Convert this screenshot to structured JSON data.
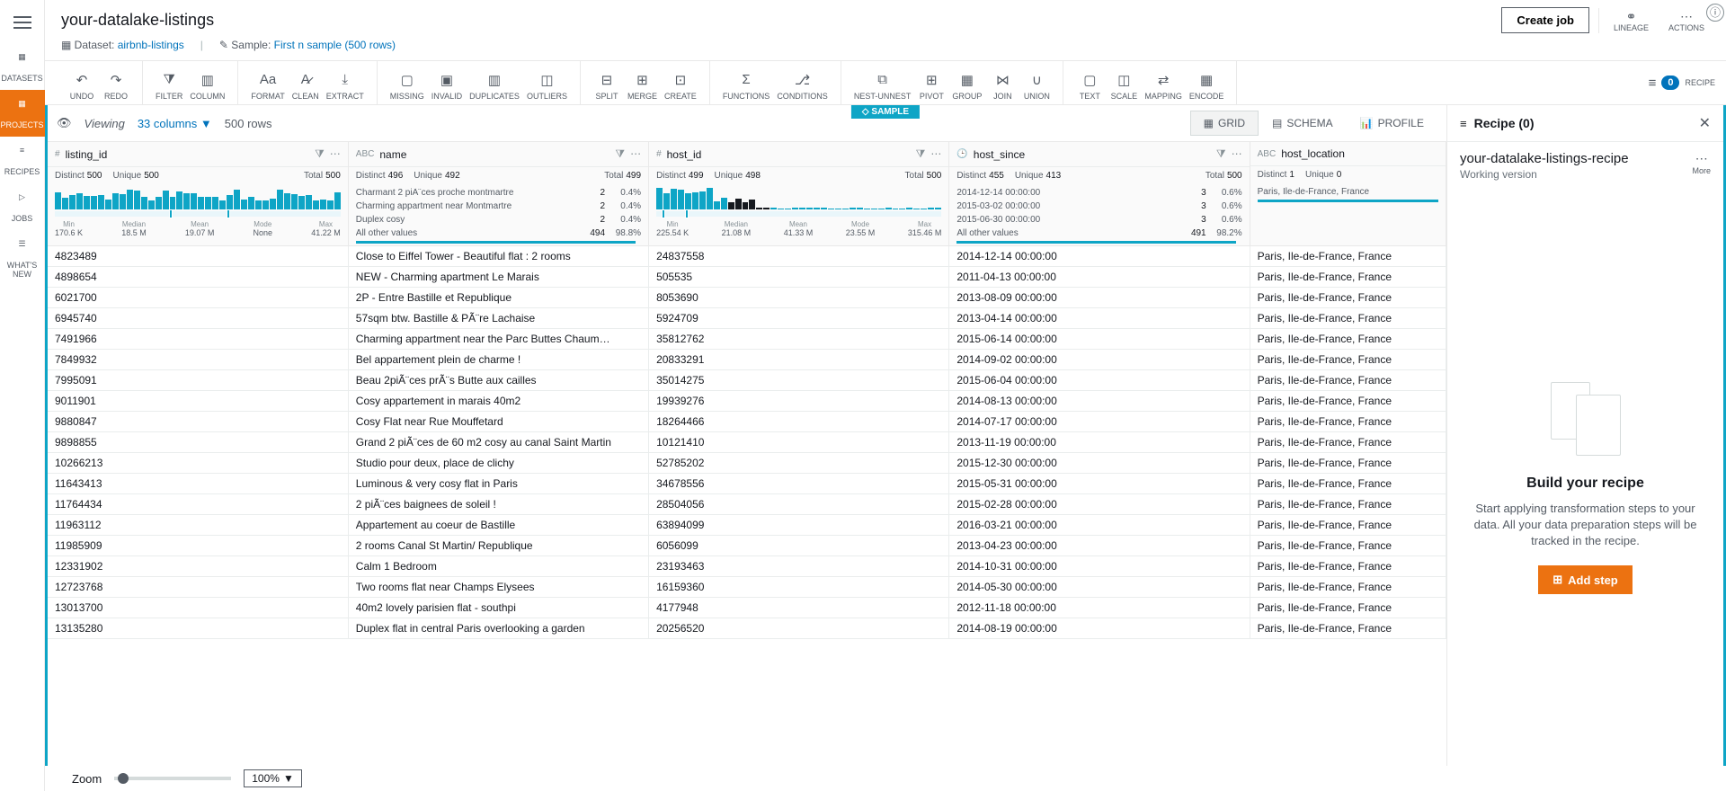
{
  "project_title": "your-datalake-listings",
  "dataset_label": "Dataset:",
  "dataset_link": "airbnb-listings",
  "sample_label": "Sample:",
  "sample_link": "First n sample (500 rows)",
  "create_job": "Create job",
  "lineage": "LINEAGE",
  "actions": "ACTIONS",
  "nav": {
    "datasets": "DATASETS",
    "projects": "PROJECTS",
    "recipes": "RECIPES",
    "jobs": "JOBS",
    "whatsnew": "WHAT'S NEW"
  },
  "toolbar": {
    "undo": "UNDO",
    "redo": "REDO",
    "filter": "FILTER",
    "column": "COLUMN",
    "format": "FORMAT",
    "clean": "CLEAN",
    "extract": "EXTRACT",
    "missing": "MISSING",
    "invalid": "INVALID",
    "duplicates": "DUPLICATES",
    "outliers": "OUTLIERS",
    "split": "SPLIT",
    "merge": "MERGE",
    "create": "CREATE",
    "functions": "FUNCTIONS",
    "conditions": "CONDITIONS",
    "nest": "NEST-UNNEST",
    "pivot": "PIVOT",
    "group": "GROUP",
    "join": "JOIN",
    "union": "UNION",
    "text": "TEXT",
    "scale": "SCALE",
    "mapping": "MAPPING",
    "encode": "ENCODE",
    "recipe": "RECIPE"
  },
  "recipe_badge": "0",
  "sample_tag": "SAMPLE",
  "viewing": "Viewing",
  "cols_count": "33 columns",
  "rows_count": "500 rows",
  "tabs": {
    "grid": "GRID",
    "schema": "SCHEMA",
    "profile": "PROFILE"
  },
  "columns": {
    "listing_id": {
      "name": "listing_id",
      "distinct": "500",
      "unique": "500",
      "total": "500",
      "summary": [
        [
          "Min",
          "170.6 K"
        ],
        [
          "Median",
          "18.5 M"
        ],
        [
          "Mean",
          "19.07 M"
        ],
        [
          "Mode",
          "None"
        ],
        [
          "Max",
          "41.22 M"
        ]
      ]
    },
    "name": {
      "name": "name",
      "distinct": "496",
      "unique": "492",
      "total": "499",
      "freq": [
        {
          "v": "Charmant 2 piÃ¨ces proche montmartre",
          "c": "2",
          "p": "0.4%"
        },
        {
          "v": "Charming appartment near Montmartre",
          "c": "2",
          "p": "0.4%"
        },
        {
          "v": "Duplex cosy",
          "c": "2",
          "p": "0.4%"
        },
        {
          "v": "All other values",
          "c": "494",
          "p": "98.8%",
          "bar": 98
        }
      ]
    },
    "host_id": {
      "name": "host_id",
      "distinct": "499",
      "unique": "498",
      "total": "500",
      "summary": [
        [
          "Min",
          "225.54 K"
        ],
        [
          "Median",
          "21.08 M"
        ],
        [
          "Mean",
          "41.33 M"
        ],
        [
          "Mode",
          "23.55 M"
        ],
        [
          "Max",
          "315.46 M"
        ]
      ]
    },
    "host_since": {
      "name": "host_since",
      "distinct": "455",
      "unique": "413",
      "total": "500",
      "freq": [
        {
          "v": "2014-12-14 00:00:00",
          "c": "3",
          "p": "0.6%"
        },
        {
          "v": "2015-03-02 00:00:00",
          "c": "3",
          "p": "0.6%"
        },
        {
          "v": "2015-06-30 00:00:00",
          "c": "3",
          "p": "0.6%"
        },
        {
          "v": "All other values",
          "c": "491",
          "p": "98.2%",
          "bar": 98
        }
      ]
    },
    "host_location": {
      "name": "host_location",
      "distinct": "1",
      "unique": "0",
      "freq": [
        {
          "v": "Paris, Ile-de-France, France"
        }
      ]
    }
  },
  "rows": [
    {
      "id": "4823489",
      "name": "Close to Eiffel Tower - Beautiful flat : 2 rooms",
      "host": "24837558",
      "since": "2014-12-14 00:00:00",
      "loc": "Paris, Ile-de-France, France"
    },
    {
      "id": "4898654",
      "name": "NEW - Charming apartment Le Marais",
      "host": "505535",
      "since": "2011-04-13 00:00:00",
      "loc": "Paris, Ile-de-France, France"
    },
    {
      "id": "6021700",
      "name": "2P - Entre Bastille et Republique",
      "host": "8053690",
      "since": "2013-08-09 00:00:00",
      "loc": "Paris, Ile-de-France, France"
    },
    {
      "id": "6945740",
      "name": "57sqm btw. Bastille & PÃ¨re Lachaise",
      "host": "5924709",
      "since": "2013-04-14 00:00:00",
      "loc": "Paris, Ile-de-France, France"
    },
    {
      "id": "7491966",
      "name": "Charming appartment near the Parc Buttes Chaum…",
      "host": "35812762",
      "since": "2015-06-14 00:00:00",
      "loc": "Paris, Ile-de-France, France"
    },
    {
      "id": "7849932",
      "name": "Bel appartement plein de charme !",
      "host": "20833291",
      "since": "2014-09-02 00:00:00",
      "loc": "Paris, Ile-de-France, France"
    },
    {
      "id": "7995091",
      "name": "Beau 2piÃ¨ces prÃ¨s Butte aux cailles",
      "host": "35014275",
      "since": "2015-06-04 00:00:00",
      "loc": "Paris, Ile-de-France, France"
    },
    {
      "id": "9011901",
      "name": "Cosy appartement in marais 40m2",
      "host": "19939276",
      "since": "2014-08-13 00:00:00",
      "loc": "Paris, Ile-de-France, France"
    },
    {
      "id": "9880847",
      "name": "Cosy Flat near Rue Mouffetard",
      "host": "18264466",
      "since": "2014-07-17 00:00:00",
      "loc": "Paris, Ile-de-France, France"
    },
    {
      "id": "9898855",
      "name": "Grand 2 piÃ¨ces de 60 m2 cosy au canal Saint Martin",
      "host": "10121410",
      "since": "2013-11-19 00:00:00",
      "loc": "Paris, Ile-de-France, France"
    },
    {
      "id": "10266213",
      "name": "Studio pour deux, place de clichy",
      "host": "52785202",
      "since": "2015-12-30 00:00:00",
      "loc": "Paris, Ile-de-France, France"
    },
    {
      "id": "11643413",
      "name": "Luminous & very cosy flat in Paris",
      "host": "34678556",
      "since": "2015-05-31 00:00:00",
      "loc": "Paris, Ile-de-France, France"
    },
    {
      "id": "11764434",
      "name": "2 piÃ¨ces baignees de soleil !",
      "host": "28504056",
      "since": "2015-02-28 00:00:00",
      "loc": "Paris, Ile-de-France, France"
    },
    {
      "id": "11963112",
      "name": "Appartement au coeur de Bastille",
      "host": "63894099",
      "since": "2016-03-21 00:00:00",
      "loc": "Paris, Ile-de-France, France"
    },
    {
      "id": "11985909",
      "name": "2 rooms Canal St Martin/ Republique",
      "host": "6056099",
      "since": "2013-04-23 00:00:00",
      "loc": "Paris, Ile-de-France, France"
    },
    {
      "id": "12331902",
      "name": "Calm 1 Bedroom",
      "host": "23193463",
      "since": "2014-10-31 00:00:00",
      "loc": "Paris, Ile-de-France, France"
    },
    {
      "id": "12723768",
      "name": "Two rooms flat near Champs Elysees",
      "host": "16159360",
      "since": "2014-05-30 00:00:00",
      "loc": "Paris, Ile-de-France, France"
    },
    {
      "id": "13013700",
      "name": "40m2 lovely parisien flat - southpi",
      "host": "4177948",
      "since": "2012-11-18 00:00:00",
      "loc": "Paris, Ile-de-France, France"
    },
    {
      "id": "13135280",
      "name": "Duplex flat in central Paris overlooking a garden",
      "host": "20256520",
      "since": "2014-08-19 00:00:00",
      "loc": "Paris, Ile-de-France, France"
    }
  ],
  "recipe_panel": {
    "title": "Recipe (0)",
    "name": "your-datalake-listings-recipe",
    "version": "Working version",
    "more": "More",
    "heading": "Build your recipe",
    "desc": "Start applying transformation steps to your data. All your data preparation steps will be tracked in the recipe.",
    "addstep": "Add step"
  },
  "zoom": {
    "label": "Zoom",
    "value": "100%"
  }
}
